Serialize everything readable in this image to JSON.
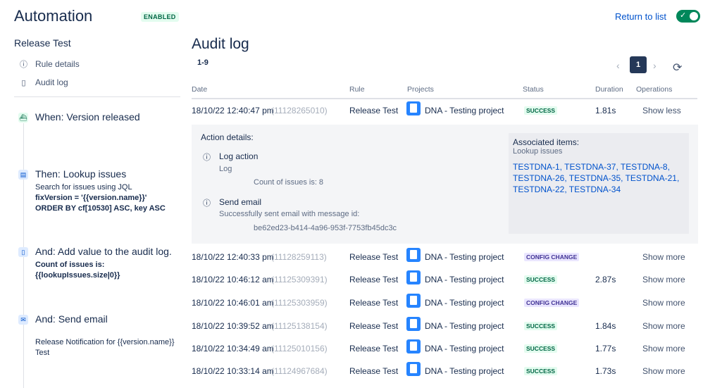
{
  "header": {
    "title": "Automation",
    "status_badge": "ENABLED",
    "return_link": "Return to list",
    "toggle_on": true
  },
  "sidebar": {
    "rule_name": "Release Test",
    "nav": [
      {
        "label": "Rule details",
        "icon": "info-icon"
      },
      {
        "label": "Audit log",
        "icon": "document-icon"
      }
    ],
    "steps": [
      {
        "title": "When: Version released",
        "icon": "ship-icon",
        "lines": []
      },
      {
        "title": "Then: Lookup issues",
        "icon": "search-issues-icon",
        "lines": [
          "Search for issues using JQL",
          "fixVersion = '{{version.name}}'",
          "ORDER BY cf[10530] ASC, key ASC"
        ]
      },
      {
        "title": "And: Add value to the audit log.",
        "icon": "document-icon",
        "lines": [
          "Count of issues is:",
          "{{lookupIssues.size|0}}"
        ]
      },
      {
        "title": "And: Send email",
        "icon": "mail-icon",
        "lines": [
          "Release Notification for {{version.name}}",
          "Test"
        ]
      }
    ]
  },
  "main": {
    "title": "Audit log",
    "range": "1-9",
    "page": "1",
    "columns": [
      "Date",
      "Rule",
      "Projects",
      "Status",
      "Duration",
      "Operations"
    ],
    "rows": [
      {
        "date": "18/10/22 12:40:47 pm",
        "id": "(11128265010)",
        "rule": "Release Test",
        "project": "DNA - Testing project",
        "status": "SUCCESS",
        "duration": "1.81s",
        "action": "Show less"
      },
      {
        "date": "18/10/22 12:40:33 pm",
        "id": "(11128259113)",
        "rule": "Release Test",
        "project": "DNA - Testing project",
        "status": "CONFIG CHANGE",
        "duration": "",
        "action": "Show more"
      },
      {
        "date": "18/10/22 10:46:12 am",
        "id": "(11125309391)",
        "rule": "Release Test",
        "project": "DNA - Testing project",
        "status": "SUCCESS",
        "duration": "2.87s",
        "action": "Show more"
      },
      {
        "date": "18/10/22 10:46:01 am",
        "id": "(11125303959)",
        "rule": "Release Test",
        "project": "DNA - Testing project",
        "status": "CONFIG CHANGE",
        "duration": "",
        "action": "Show more"
      },
      {
        "date": "18/10/22 10:39:52 am",
        "id": "(11125138154)",
        "rule": "Release Test",
        "project": "DNA - Testing project",
        "status": "SUCCESS",
        "duration": "1.84s",
        "action": "Show more"
      },
      {
        "date": "18/10/22 10:34:49 am",
        "id": "(11125010156)",
        "rule": "Release Test",
        "project": "DNA - Testing project",
        "status": "SUCCESS",
        "duration": "1.77s",
        "action": "Show more"
      },
      {
        "date": "18/10/22 10:33:14 am",
        "id": "(11124967684)",
        "rule": "Release Test",
        "project": "DNA - Testing project",
        "status": "SUCCESS",
        "duration": "1.73s",
        "action": "Show more"
      }
    ],
    "details": {
      "title": "Action details:",
      "actions": [
        {
          "name": "Log action",
          "sub": "Log",
          "value": "Count of issues is: 8"
        },
        {
          "name": "Send email",
          "sub": "Successfully sent email with message id:",
          "value": "be62ed23-b414-4a96-953f-7753fb45dc3c"
        }
      ],
      "associated_title": "Associated items:",
      "associated_sub": "Lookup issues",
      "associated_lines": [
        "TESTDNA-1, TESTDNA-37, TESTDNA-8,",
        "TESTDNA-26, TESTDNA-35, TESTDNA-21,",
        "TESTDNA-22, TESTDNA-34"
      ]
    }
  }
}
